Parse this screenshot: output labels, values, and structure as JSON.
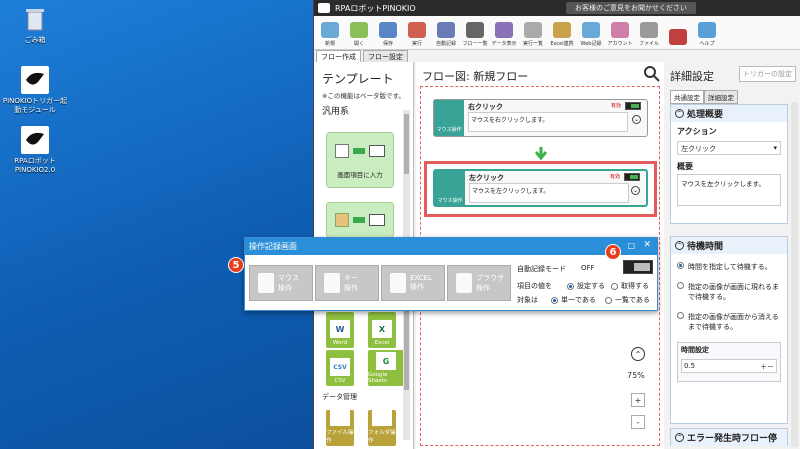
{
  "desktop": {
    "icons": [
      {
        "label": "ごみ箱"
      },
      {
        "label": "PINOKIOトリガー起動モジュール"
      },
      {
        "label": "RPAロボットPINOKIO2.0"
      }
    ]
  },
  "app": {
    "title": "RPAロボットPINOKIO",
    "banner": "お客様のご意見をお聞かせください"
  },
  "ribbon": {
    "items": [
      "新規",
      "開く",
      "保存",
      "実行",
      "自動記録",
      "フロー一覧",
      "データ表示",
      "実行一覧",
      "Excel連携",
      "Web記録",
      "アカウント",
      "ファイル",
      "",
      "ヘルプ"
    ]
  },
  "tabs": [
    "フロー作成",
    "フロー設定"
  ],
  "left": {
    "title": "テンプレート",
    "note": "※この機能はベータ版です。",
    "section": "汎用系",
    "card1_caption": "画面項目に入力",
    "mini": [
      {
        "label": "Word"
      },
      {
        "label": "Excel"
      },
      {
        "label": "CSV"
      },
      {
        "label": "Google Sheets"
      }
    ],
    "data_section": "データ管理",
    "file": [
      {
        "label": "ファイル操作"
      },
      {
        "label": "フォルダ操作"
      }
    ]
  },
  "flow": {
    "title": "フロー図: 新規フロー",
    "nodes": [
      {
        "title": "右クリック",
        "desc": "マウスを右クリックします。",
        "valid": "有効",
        "side": "マウス操作"
      },
      {
        "title": "左クリック",
        "desc": "マウスを左クリックします。",
        "valid": "有効",
        "side": "マウス操作"
      }
    ],
    "zoom": "75%"
  },
  "detail": {
    "title": "詳細設定",
    "trigger_btn": "トリガーの設定",
    "tab1": "共通設定",
    "tab2": "詳細設定",
    "sec1": "処理概要",
    "action_label": "アクション",
    "action_value": "左クリック",
    "summary_label": "概要",
    "summary_value": "マウスを左クリックします。",
    "sec2": "待機時間",
    "opt1": "時間を指定して待機する。",
    "opt2": "指定の画像が画面に現れるまで待機する。",
    "opt3": "指定の画像が画面から消えるまで待機する。",
    "time_label": "時間設定",
    "time_value": "0.5",
    "sec3": "エラー発生時フロー停"
  },
  "recorder": {
    "title": "操作記録画面",
    "buttons": [
      {
        "label": "マウス\n操作"
      },
      {
        "label": "キー\n操作"
      },
      {
        "label": "EXCEL\n操作"
      },
      {
        "label": "ブラウザ\n操作"
      }
    ],
    "auto_label": "自動記録モード",
    "auto_value": "OFF",
    "item_label": "項目の値を",
    "item_opt1": "設定する",
    "item_opt2": "取得する",
    "target_label": "対象は",
    "target_opt1": "単一である",
    "target_opt2": "一覧である"
  },
  "badges": [
    "5",
    "6"
  ]
}
